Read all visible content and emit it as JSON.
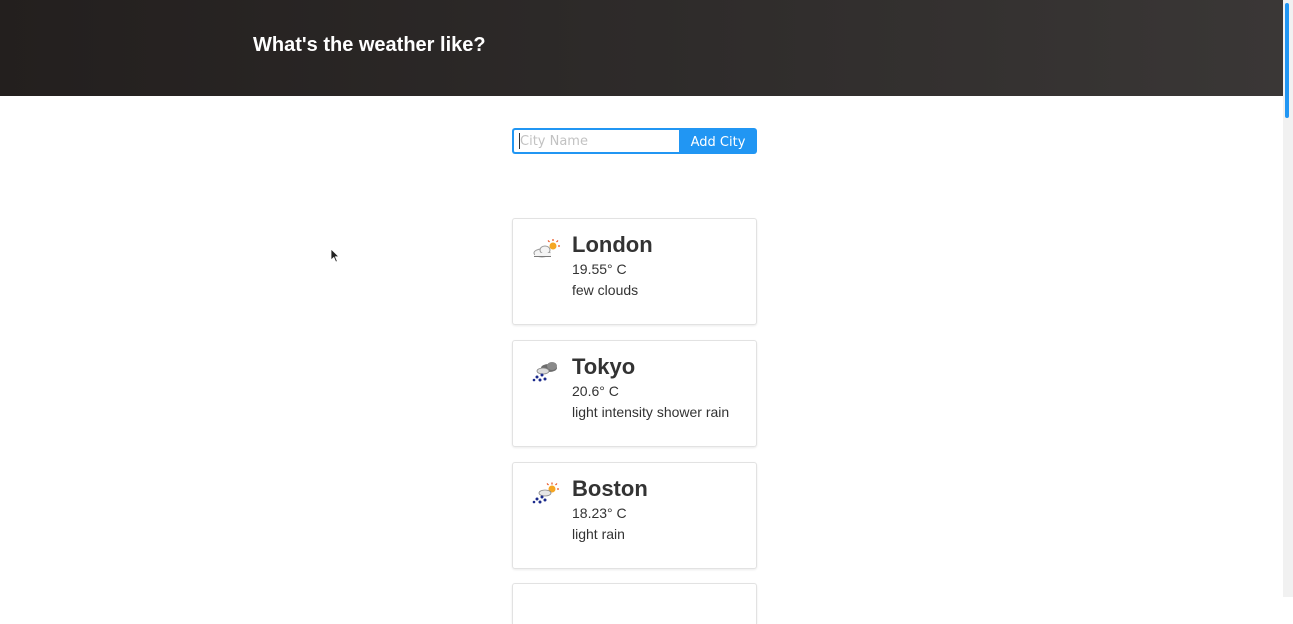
{
  "header": {
    "title": "What's the weather like?"
  },
  "search": {
    "placeholder": "City Name",
    "value": "",
    "button_label": "Add City"
  },
  "cities": [
    {
      "name": "London",
      "temp": "19.55° C",
      "description": "few clouds",
      "icon": "few-clouds-icon"
    },
    {
      "name": "Tokyo",
      "temp": "20.6° C",
      "description": "light intensity shower rain",
      "icon": "shower-rain-icon"
    },
    {
      "name": "Boston",
      "temp": "18.23° C",
      "description": "light rain",
      "icon": "light-rain-icon"
    }
  ],
  "colors": {
    "accent": "#2196f3",
    "header_bg": "#2a2625",
    "text": "#333333",
    "card_border": "#e2e2e2"
  }
}
